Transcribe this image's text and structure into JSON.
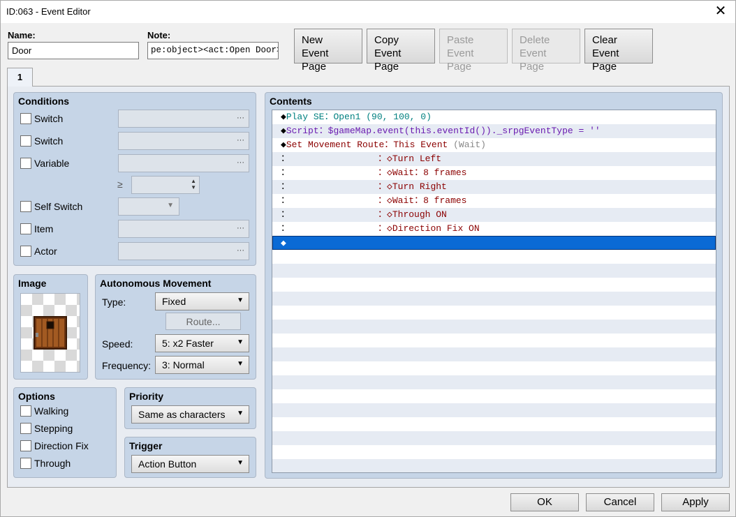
{
  "window": {
    "title": "ID:063 - Event Editor",
    "close": "✕"
  },
  "header": {
    "name_label": "Name:",
    "name_value": "Door",
    "note_label": "Note:",
    "note_value": "pe:object><act:Open Door>"
  },
  "toolbar": {
    "new": "New\nEvent Page",
    "copy": "Copy\nEvent Page",
    "paste": "Paste\nEvent Page",
    "delete": "Delete\nEvent Page",
    "clear": "Clear\nEvent Page"
  },
  "tabs": [
    "1"
  ],
  "conditions": {
    "title": "Conditions",
    "switch1": "Switch",
    "switch2": "Switch",
    "variable": "Variable",
    "ge": "≥",
    "self_switch": "Self Switch",
    "item": "Item",
    "actor": "Actor",
    "dots": "···"
  },
  "image": {
    "title": "Image",
    "icon": "door-icon"
  },
  "movement": {
    "title": "Autonomous Movement",
    "type_label": "Type:",
    "type_value": "Fixed",
    "route_btn": "Route...",
    "speed_label": "Speed:",
    "speed_value": "5: x2 Faster",
    "freq_label": "Frequency:",
    "freq_value": "3: Normal"
  },
  "options": {
    "title": "Options",
    "walking": "Walking",
    "stepping": "Stepping",
    "direction_fix": "Direction Fix",
    "through": "Through"
  },
  "priority": {
    "title": "Priority",
    "value": "Same as characters"
  },
  "trigger": {
    "title": "Trigger",
    "value": "Action Button"
  },
  "contents": {
    "title": "Contents",
    "lines": {
      "l1": {
        "mark": "◆",
        "cmd": "Play SE",
        "sep": "：",
        "arg": "Open1 (90, 100, 0)"
      },
      "l2": {
        "mark": "◆",
        "cmd": "Script",
        "sep": "：",
        "arg": "$gameMap.event(this.eventId())._srpgEventType = ''"
      },
      "l3": {
        "mark": "◆",
        "cmd": "Set Movement Route",
        "sep": "：",
        "arg": "This Event ",
        "arg2": "(Wait)"
      },
      "l4": {
        "lead": "：",
        "sep": "：",
        "mark": "◇",
        "cmd": "Turn Left"
      },
      "l5": {
        "lead": "：",
        "sep": "：",
        "mark": "◇",
        "cmd": "Wait",
        "sep2": "：",
        "arg": "8 frames"
      },
      "l6": {
        "lead": "：",
        "sep": "：",
        "mark": "◇",
        "cmd": "Turn Right"
      },
      "l7": {
        "lead": "：",
        "sep": "：",
        "mark": "◇",
        "cmd": "Wait",
        "sep2": "：",
        "arg": "8 frames"
      },
      "l8": {
        "lead": "：",
        "sep": "：",
        "mark": "◇",
        "cmd": "Through ON"
      },
      "l9": {
        "lead": "：",
        "sep": "：",
        "mark": "◇",
        "cmd": "Direction Fix ON"
      },
      "l10": {
        "mark": "◆"
      }
    }
  },
  "footer": {
    "ok": "OK",
    "cancel": "Cancel",
    "apply": "Apply"
  },
  "colors": {
    "selection": "#0a6ad5",
    "panel": "#c6d5e7",
    "teal": "#008080",
    "purple": "#6a1bb0",
    "darkred": "#8b0000"
  }
}
